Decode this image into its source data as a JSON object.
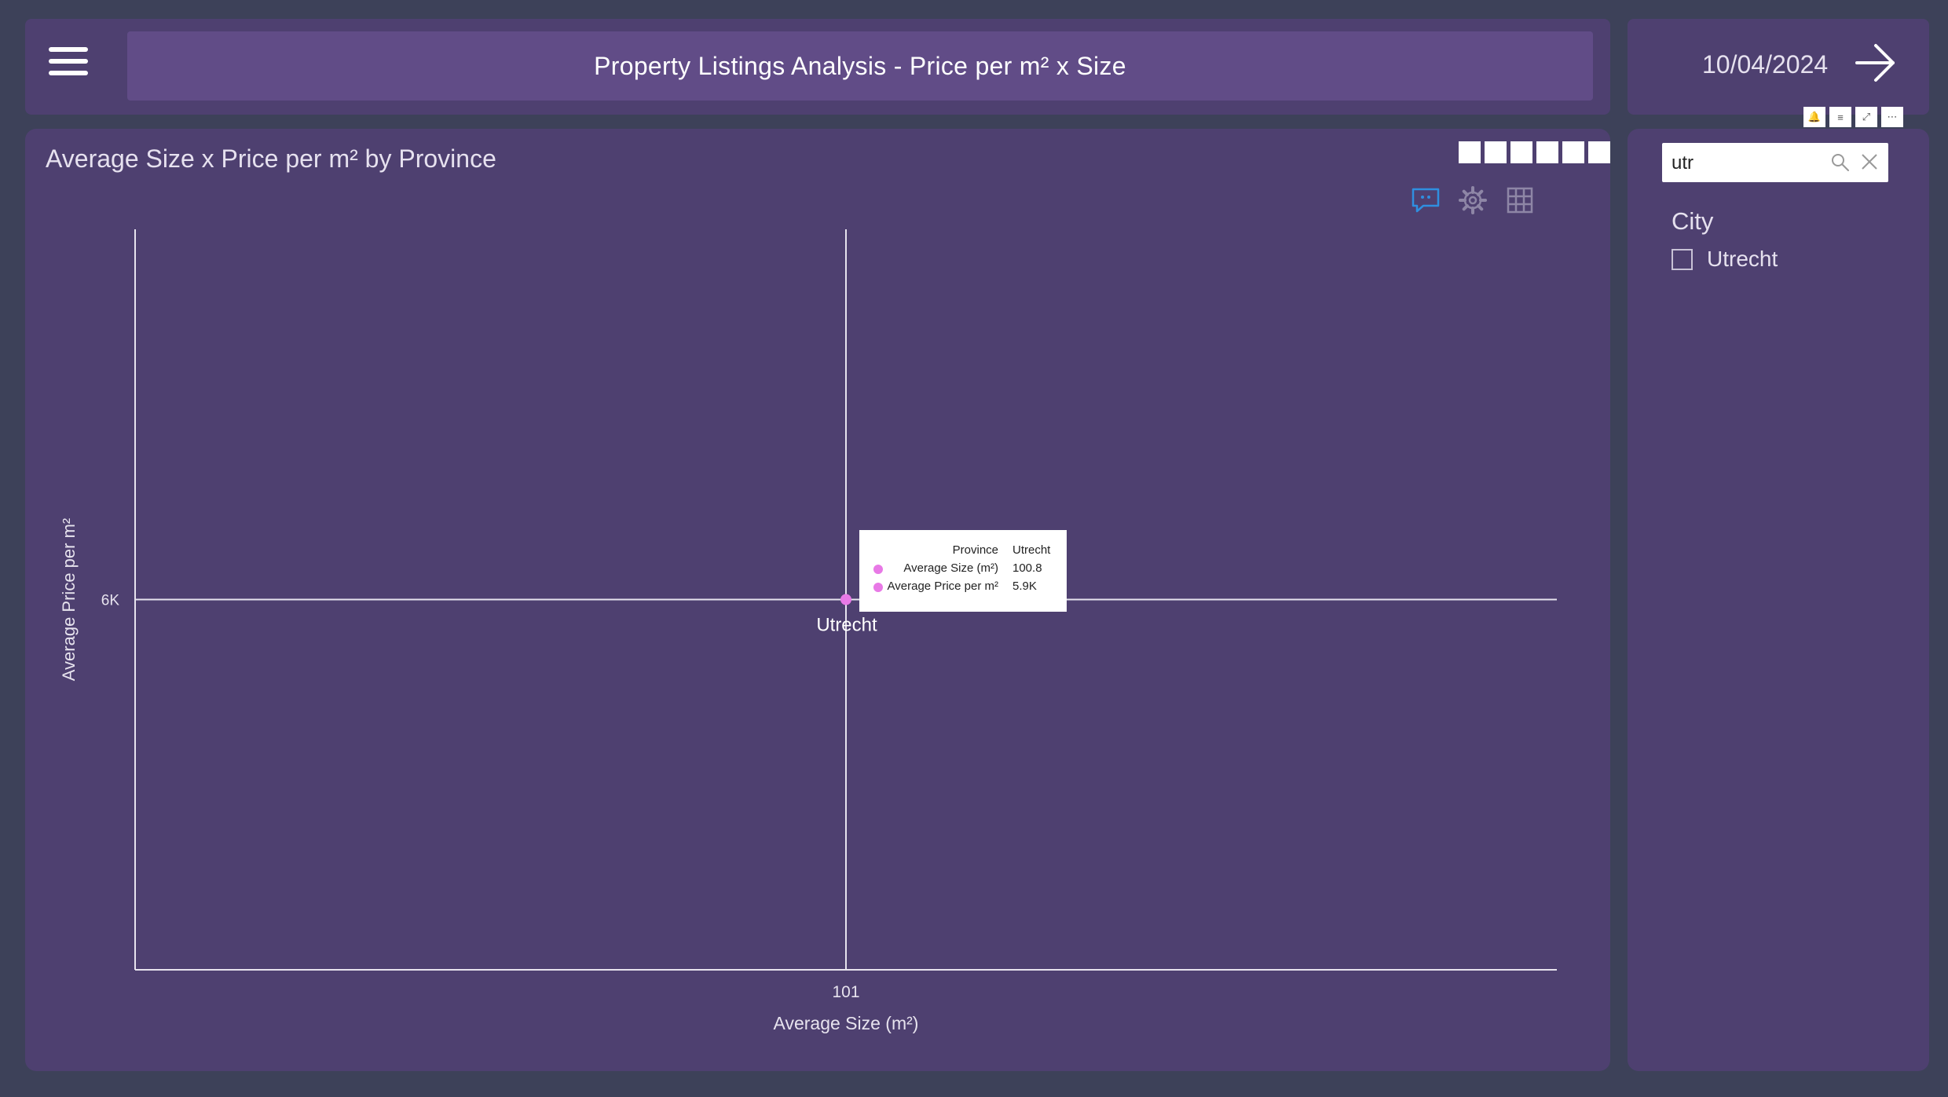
{
  "header": {
    "title": "Property Listings Analysis - Price per m² x Size",
    "menu_icon": "hamburger-menu-icon"
  },
  "date_panel": {
    "date": "10/04/2024",
    "next_icon": "arrow-right-icon"
  },
  "visual_header": {
    "buttons": [
      {
        "name": "bell-icon",
        "glyph": "🔔"
      },
      {
        "name": "filter-icon",
        "glyph": "≡"
      },
      {
        "name": "focus-mode-icon",
        "glyph": "⤢"
      },
      {
        "name": "more-options-icon",
        "glyph": "⋯"
      }
    ]
  },
  "chart_panel": {
    "title": "Average Size x Price per m² by Province",
    "tools": [
      "comment-icon",
      "settings-gear-icon",
      "table-grid-icon"
    ]
  },
  "chart_data": {
    "type": "scatter",
    "title": "Average Size x Price per m² by Province",
    "xlabel": "Average Size (m²)",
    "ylabel": "Average Price per m²",
    "x_ticks": [
      "101"
    ],
    "y_ticks": [
      "6K"
    ],
    "points": [
      {
        "label": "Utrecht",
        "x": 100.8,
        "y": 5900
      }
    ],
    "point_color": "#e879e6",
    "crosshair": true,
    "tooltip": {
      "rows": [
        {
          "key": "Province",
          "value": "Utrecht"
        },
        {
          "key": "Average Size (m²)",
          "value": "100.8"
        },
        {
          "key": "Average Price per m²",
          "value": "5.9K"
        }
      ]
    }
  },
  "filter": {
    "search_value": "utr",
    "search_icon": "search-icon",
    "clear_icon": "close-icon",
    "heading": "City",
    "items": [
      {
        "label": "Utrecht",
        "checked": false
      }
    ]
  },
  "colors": {
    "background": "#3d4159",
    "panel": "#4e4070",
    "title_bar": "#614c87",
    "accent_point": "#e879e6",
    "comment_icon": "#2f8fe0"
  }
}
